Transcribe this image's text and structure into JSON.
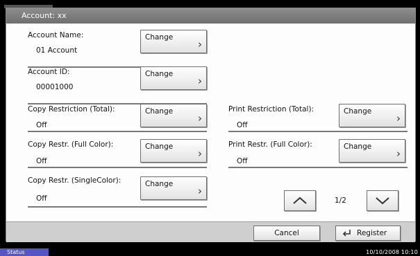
{
  "title": "Account: xx",
  "change_label": "Change",
  "fields": [
    {
      "label": "Account Name:",
      "value": "01 Account"
    },
    {
      "label": "Account ID:",
      "value": "00001000"
    },
    {
      "label": "Copy Restriction (Total):",
      "value": "Off"
    },
    {
      "label": "Print Restriction (Total):",
      "value": "Off"
    },
    {
      "label": "Copy Restr. (Full Color):",
      "value": "Off"
    },
    {
      "label": "Print Restr. (Full Color):",
      "value": "Off"
    },
    {
      "label": "Copy Restr. (SingleColor):",
      "value": "Off"
    }
  ],
  "pagination": {
    "indicator": "1/2"
  },
  "footer": {
    "cancel_label": "Cancel",
    "register_label": "Register"
  },
  "status": {
    "label": "Status",
    "datetime": "10/10/2008   10:10"
  },
  "colors": {
    "status_tab": "#5454c2",
    "titlebar": "#7a7a7a"
  },
  "icons": {
    "chevron": "chevron-right-icon",
    "up": "arrow-up-icon",
    "down": "arrow-down-icon",
    "register": "enter-icon"
  }
}
